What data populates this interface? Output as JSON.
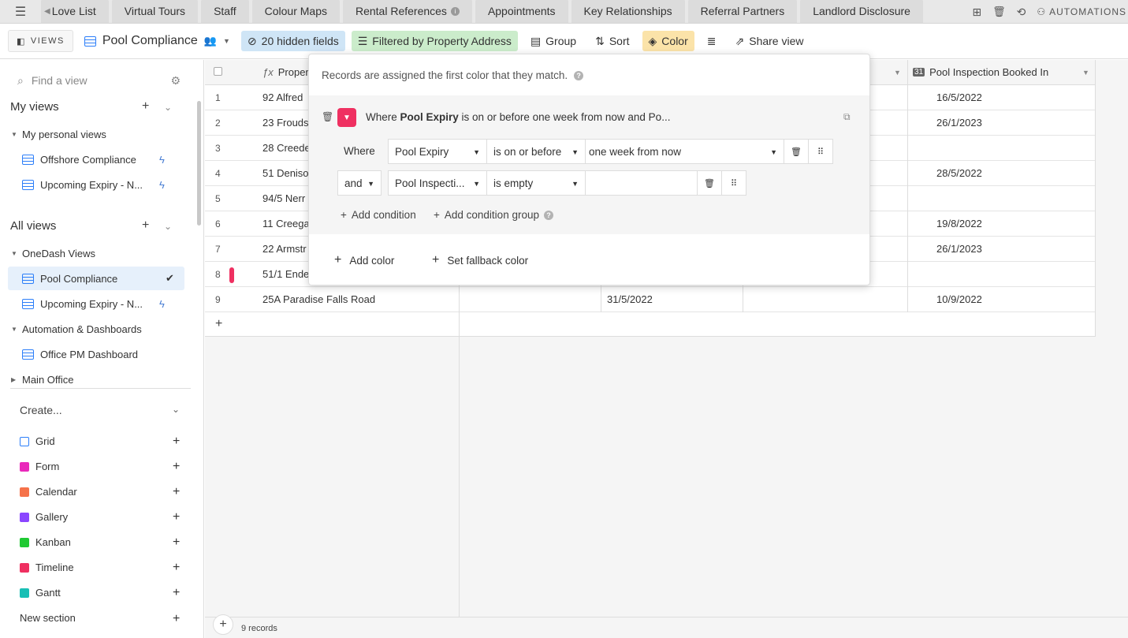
{
  "tabs": [
    "Love List",
    "Virtual Tours",
    "Staff",
    "Colour Maps",
    "Rental References",
    "Appointments",
    "Key Relationships",
    "Referral Partners",
    "Landlord Disclosure"
  ],
  "top_right": {
    "automations": "AUTOMATIONS"
  },
  "viewbar": {
    "views_label": "VIEWS",
    "view_name": "Pool Compliance",
    "hidden_fields": "20 hidden fields",
    "filter": "Filtered by Property Address",
    "group": "Group",
    "sort": "Sort",
    "color": "Color",
    "share": "Share view"
  },
  "sidebar": {
    "search_placeholder": "Find a view",
    "my_views": "My views",
    "my_personal_views": "My personal views",
    "personal_items": [
      "Offshore Compliance",
      "Upcoming Expiry - N..."
    ],
    "all_views": "All views",
    "onedash_group": "OneDash Views",
    "onedash_items": [
      "Pool Compliance",
      "Upcoming Expiry - N..."
    ],
    "automation_group": "Automation & Dashboards",
    "automation_items": [
      "Office PM Dashboard"
    ],
    "main_office": "Main Office",
    "create": "Create...",
    "create_items": [
      "Grid",
      "Form",
      "Calendar",
      "Gallery",
      "Kanban",
      "Timeline",
      "Gantt"
    ],
    "new_section": "New section"
  },
  "grid": {
    "col_property": "Proper",
    "col_inspection": "Pool Inspection Booked In",
    "rows": [
      {
        "n": "1",
        "prop": "92 Alfred",
        "c2": "",
        "c4": "16/5/2022"
      },
      {
        "n": "2",
        "prop": "23 Frouds",
        "c2": "",
        "c4": "26/1/2023"
      },
      {
        "n": "3",
        "prop": "28 Creede",
        "c2": "",
        "c4": ""
      },
      {
        "n": "4",
        "prop": "51 Deniso",
        "c2": "",
        "c4": "28/5/2022"
      },
      {
        "n": "5",
        "prop": "94/5 Nerr",
        "c2": "",
        "c4": ""
      },
      {
        "n": "6",
        "prop": "11 Creega",
        "c2": "",
        "c4": "19/8/2022"
      },
      {
        "n": "7",
        "prop": "22 Armstr",
        "c2": "",
        "c4": "26/1/2023"
      },
      {
        "n": "8",
        "prop": "51/1 Ende",
        "c2": "",
        "c4": ""
      },
      {
        "n": "9",
        "prop": "25A Paradise Falls Road",
        "c2": "31/5/2022",
        "c4": "10/9/2022"
      }
    ],
    "record_count": "9 records"
  },
  "popover": {
    "hint": "Records are assigned the first color that they match.",
    "rule_title_prefix": "Where ",
    "rule_title_field": "Pool Expiry",
    "rule_title_rest": " is on or before one week from now and Po...",
    "cond1": {
      "conj": "Where",
      "field": "Pool Expiry",
      "op": "is on or before",
      "value": "one week from now"
    },
    "cond2": {
      "conj": "and",
      "field": "Pool Inspecti...",
      "op": "is empty",
      "value": ""
    },
    "add_condition": "Add condition",
    "add_condition_group": "Add condition group",
    "add_color": "Add color",
    "set_fallback": "Set fallback color",
    "rule_color": "#ef3061"
  }
}
